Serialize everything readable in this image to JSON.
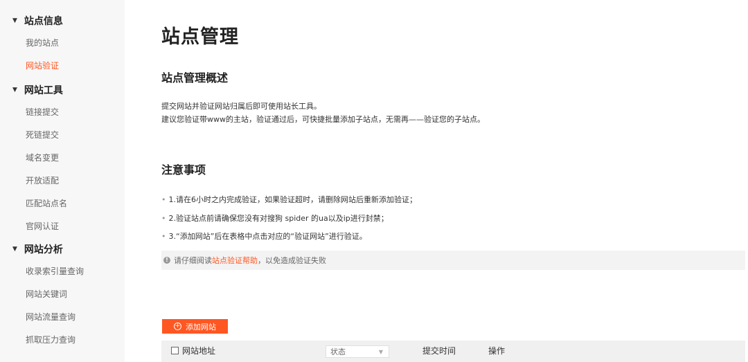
{
  "sidebar": {
    "sections": [
      {
        "label": "站点信息",
        "items": [
          {
            "label": "我的站点"
          },
          {
            "label": "网站验证",
            "active": true
          }
        ]
      },
      {
        "label": "网站工具",
        "items": [
          {
            "label": "链接提交"
          },
          {
            "label": "死链提交"
          },
          {
            "label": "域名变更"
          },
          {
            "label": "开放适配"
          },
          {
            "label": "匹配站点名"
          },
          {
            "label": "官网认证"
          }
        ]
      },
      {
        "label": "网站分析",
        "items": [
          {
            "label": "收录索引量查询"
          },
          {
            "label": "网站关键词"
          },
          {
            "label": "网站流量查询"
          },
          {
            "label": "抓取压力查询"
          }
        ]
      }
    ]
  },
  "main": {
    "title": "站点管理",
    "overview_title": "站点管理概述",
    "overview_lines": [
      "提交网站并验证网站归属后即可使用站长工具。",
      "建议您验证带www的主站，验证通过后，可快捷批量添加子站点，无需再——验证您的子站点。"
    ],
    "notes_title": "注意事项",
    "notes": [
      "1.请在6小时之内完成验证，如果验证超时，请删除网站后重新添加验证；",
      "2.验证站点前请确保您没有对搜狗 spider 的ua以及ip进行封禁；",
      "3.“添加网站”后在表格中点击对应的“验证网站”进行验证。"
    ],
    "notice": {
      "prefix": "请仔细阅读",
      "link": "站点验证帮助",
      "suffix": "，以免造成验证失败"
    },
    "add_button": "添加网站",
    "table": {
      "col_site": "网站地址",
      "col_status": "状态",
      "col_time": "提交时间",
      "col_action": "操作"
    }
  },
  "colors": {
    "accent": "#ff5722",
    "sidebar_bg": "#f7f7f7"
  }
}
